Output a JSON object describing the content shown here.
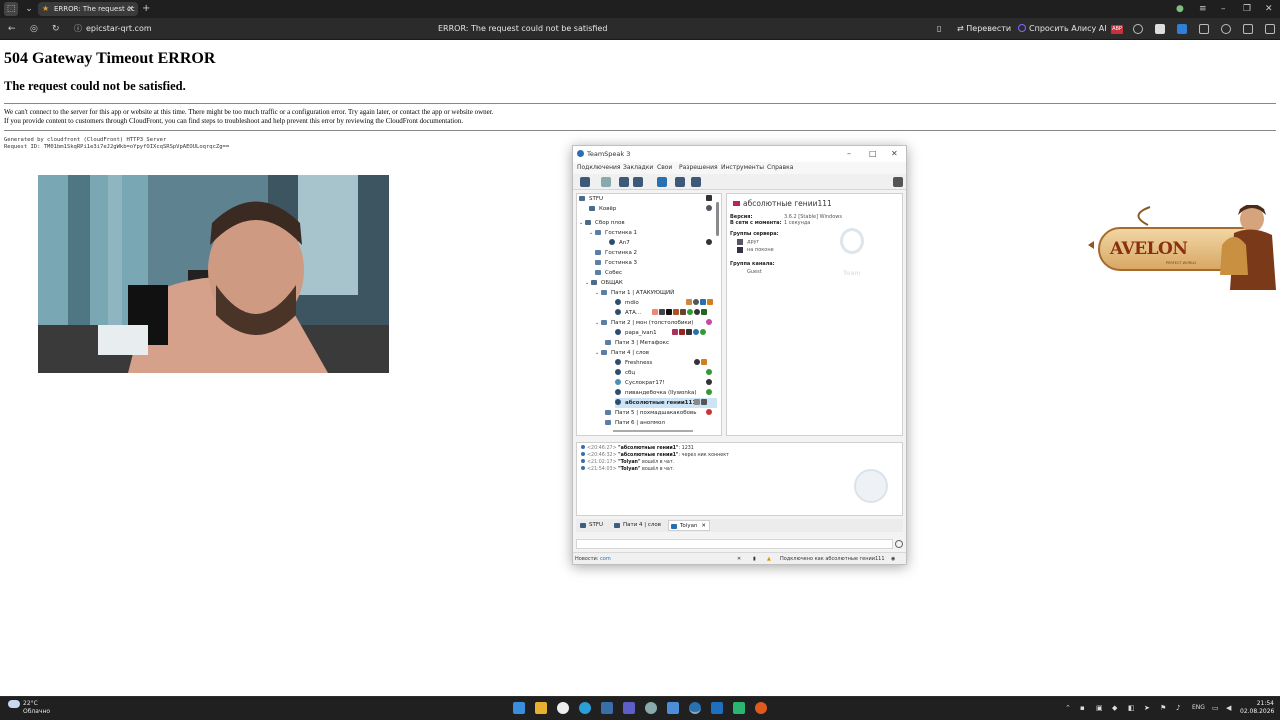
{
  "browser": {
    "tab_title": "ERROR: The request cc",
    "url": "epicstar-qrt.com",
    "page_title": "ERROR: The request could not be satisfied",
    "translate_label": "Перевести",
    "alice_label": "Спросить Алису AI",
    "abp_label": "ABP"
  },
  "error_page": {
    "heading": "504 Gateway Timeout ERROR",
    "subheading": "The request could not be satisfied.",
    "paragraph_line1": "We can't connect to the server for this app or website at this time. There might be too much traffic or a configuration error. Try again later, or contact the app or website owner.",
    "paragraph_line2": "If you provide content to customers through CloudFront, you can find steps to troubleshoot and help prevent this error by reviewing the CloudFront documentation.",
    "generated_by": "Generated by cloudfront (CloudFront) HTTP3 Server",
    "request_id": "Request ID: TM01bm1SkqRPi1e3i7eJ2gWkb=oYpyfOIXcqSRSpVpAEOULoqrqcZg=="
  },
  "teamspeak": {
    "window_title": "TeamSpeak 3",
    "menu": [
      "Подключения",
      "Закладки",
      "Свои",
      "Разрешения",
      "Инструменты",
      "Справка"
    ],
    "tree": [
      {
        "label": "STFU",
        "type": "server",
        "level": 0
      },
      {
        "label": "Ковёр",
        "type": "channel",
        "level": 1
      },
      {
        "label": "Сбор плов",
        "type": "channel",
        "level": 1,
        "expanded": true
      },
      {
        "label": "Гостинка 1",
        "type": "channel",
        "level": 2,
        "expanded": true
      },
      {
        "label": "An7",
        "type": "client",
        "level": 3
      },
      {
        "label": "Гостинка 2",
        "type": "channel",
        "level": 2
      },
      {
        "label": "Гостинка 3",
        "type": "channel",
        "level": 2
      },
      {
        "label": "Собес",
        "type": "channel",
        "level": 2
      },
      {
        "label": "ОБЩАК",
        "type": "channel",
        "level": 1,
        "expanded": true
      },
      {
        "label": "Пати 1 | АТАКУЮЩИЙ",
        "type": "channel",
        "level": 2,
        "expanded": true
      },
      {
        "label": "mdio",
        "type": "client",
        "level": 3
      },
      {
        "label": "АТА...",
        "type": "client",
        "level": 3
      },
      {
        "label": "Пати 2 | мон (толстолобики)",
        "type": "channel",
        "level": 2,
        "expanded": true
      },
      {
        "label": "papa_ivan1",
        "type": "client",
        "level": 3
      },
      {
        "label": "Пати 3 | Метафокс",
        "type": "channel",
        "level": 2
      },
      {
        "label": "Пати 4 | слов",
        "type": "channel",
        "level": 2,
        "expanded": true
      },
      {
        "label": "Freshness",
        "type": "client",
        "level": 3
      },
      {
        "label": "сбц",
        "type": "client",
        "level": 3
      },
      {
        "label": "Суслократ17!",
        "type": "client",
        "level": 3
      },
      {
        "label": "пивандебочка (Ilywonka)",
        "type": "client",
        "level": 3
      },
      {
        "label": "абсолютные гении111",
        "type": "client",
        "level": 3,
        "selected": true
      },
      {
        "label": "Пати 5 | похмадшакакобовь",
        "type": "channel",
        "level": 2
      },
      {
        "label": "Пати 6 | анопмол",
        "type": "channel",
        "level": 2
      }
    ],
    "info": {
      "client_name": "абсолютные гении111",
      "version_label": "Версия:",
      "version_value": "3.6.2 [Stable] Windows",
      "online_label": "В сети с момента:",
      "online_value": "1 секунда",
      "server_groups_label": "Группы сервера:",
      "server_groups": [
        "друг",
        "на поконе"
      ],
      "channel_group_label": "Группа канала:",
      "channel_group": "Guest",
      "logo_text": "Team"
    },
    "log": [
      {
        "time": "<20:46:27>",
        "name": "\"абсолютные гении1\"",
        "text": ": 1231"
      },
      {
        "time": "<20:46:32>",
        "name": "\"абсолютные гении1\"",
        "text": ": через ник коннект"
      },
      {
        "time": "<21:02:17>",
        "name": "\"Tolyan\"",
        "text": " вошёл в чат."
      },
      {
        "time": "<21:54:03>",
        "name": "\"Tolyan\"",
        "text": " вошёл в чат."
      }
    ],
    "tabs": [
      "STFU",
      "Пати 4 | слов",
      "Tolyan"
    ],
    "status_news_label": "Новости:",
    "status_news_link": "com",
    "status_connected": "Подключено как абсолютные гении111"
  },
  "ad": {
    "brand": "AVELON",
    "tagline": "PERFECT WORLD"
  },
  "taskbar": {
    "temperature": "22°C",
    "weather": "Облачно",
    "language": "ENG",
    "time": "21:54",
    "date": "02.08.2026"
  },
  "colors": {
    "chrome_dark": "#1f1f1f",
    "accent_ts": "#2a6fb0",
    "error_text": "#000000"
  }
}
